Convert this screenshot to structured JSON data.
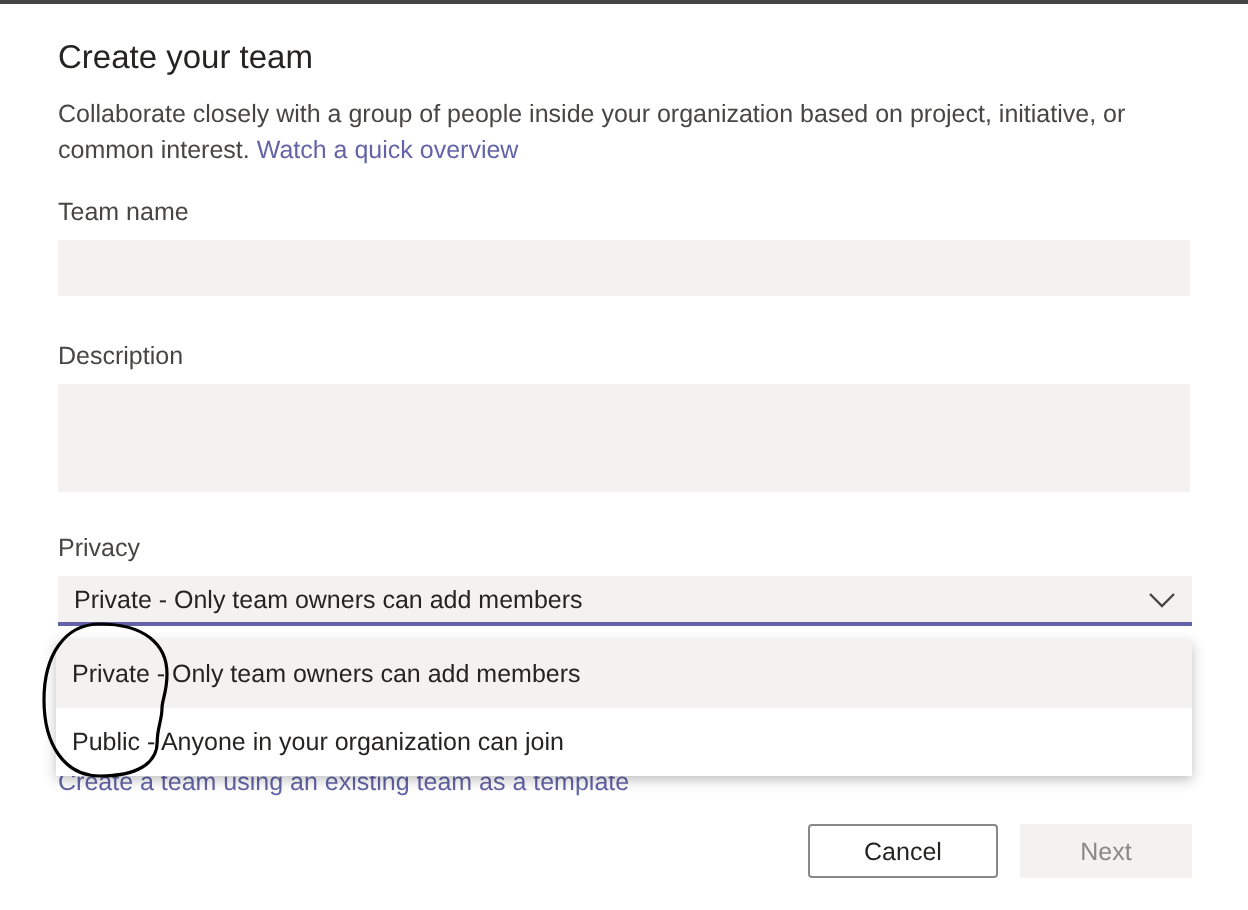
{
  "dialog": {
    "title": "Create your team",
    "description": "Collaborate closely with a group of people inside your organization based on project, initiative, or common interest.",
    "link": "Watch a quick overview",
    "fields": [
      {
        "label": "Team name",
        "kind": "input"
      },
      {
        "label": "Description",
        "kind": "textarea"
      }
    ],
    "privacy": {
      "label": "Privacy",
      "value": "Private - Only team owners can add members",
      "expanded": true,
      "options": [
        {
          "label": "Private - Only team owners can add members",
          "selected": true
        },
        {
          "label": "Public - Anyone in your organization can join",
          "selected": false
        }
      ]
    },
    "template_link": "Create a team using an existing team as a template",
    "buttons": [
      {
        "label": "Cancel",
        "disabled": false
      },
      {
        "label": "Next",
        "disabled": true
      }
    ]
  }
}
